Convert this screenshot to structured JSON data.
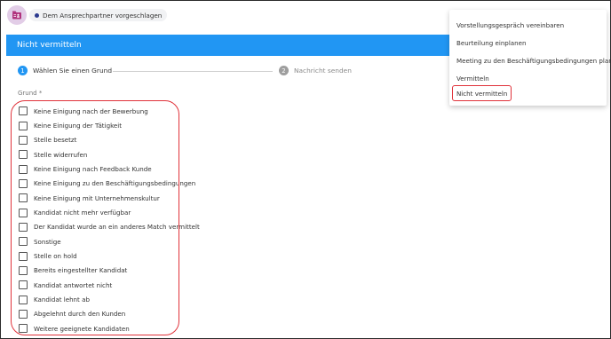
{
  "contact_chip": {
    "text": "Dem Ansprechpartner vorgeschlagen"
  },
  "panel": {
    "title": "Nicht vermitteln"
  },
  "stepper": {
    "steps": [
      {
        "number": "1",
        "label": "Wählen Sie einen Grund"
      },
      {
        "number": "2",
        "label": "Nachricht senden"
      }
    ]
  },
  "form": {
    "field_label": "Grund *",
    "options": [
      "Keine Einigung nach der Bewerbung",
      "Keine Einigung der Tätigkeit",
      "Stelle besetzt",
      "Stelle widerrufen",
      "Keine Einigung nach Feedback Kunde",
      "Keine Einigung zu den Beschäftigungsbedingungen",
      "Keine Einigung mit Unternehmenskultur",
      "Kandidat nicht mehr verfügbar",
      "Der Kandidat wurde an ein anderes Match vermittelt",
      "Sonstige",
      "Stelle on hold",
      "Bereits eingestellter Kandidat",
      "Kandidat antwortet nicht",
      "Kandidat lehnt ab",
      "Abgelehnt durch den Kunden",
      "Weitere geeignete Kandidaten"
    ]
  },
  "menu": {
    "items": [
      "Vorstellungsgespräch vereinbaren",
      "Beurteilung einplanen",
      "Meeting zu den Beschäftigungsbedingungen planen",
      "Vermitteln",
      "Nicht vermitteln"
    ],
    "selected": "Nicht vermitteln"
  },
  "colors": {
    "header_blue": "#2196f3",
    "highlight_red": "#e0323a",
    "app_icon_bg": "#e2cde7",
    "app_icon_fg": "#b0337e"
  }
}
